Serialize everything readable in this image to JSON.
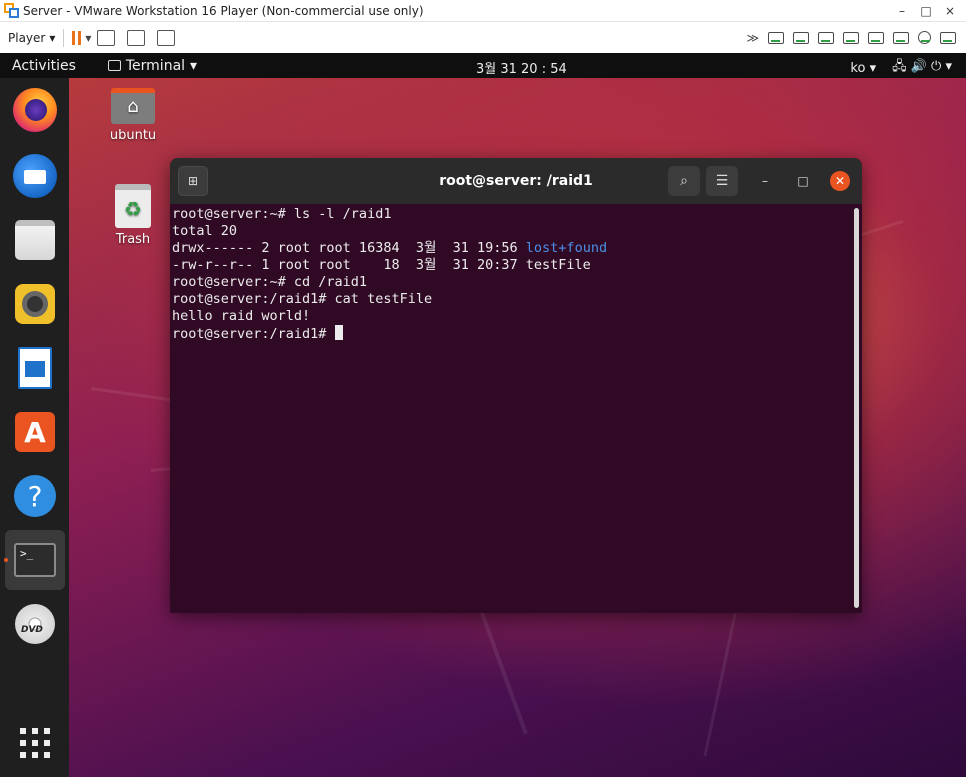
{
  "vmware": {
    "title": "Server - VMware Workstation 16 Player (Non-commercial use only)",
    "minimize": "–",
    "maximize": "□",
    "close": "×",
    "player_label": "Player",
    "player_caret": "▾",
    "more": "≫"
  },
  "topbar": {
    "activities": "Activities",
    "app_menu": "Terminal",
    "app_caret": "▾",
    "clock": "3월 31  20 : 54",
    "input_method": "ko ▾",
    "status_icons": "🖧  🔊  ⏻ ▾"
  },
  "desktop": {
    "home_label": "ubuntu",
    "trash_label": "Trash"
  },
  "dock": {
    "items": [
      "firefox",
      "thunderbird",
      "files",
      "rhythmbox",
      "libreoffice-writer",
      "software",
      "help",
      "terminal",
      "dvd"
    ]
  },
  "terminal": {
    "title": "root@server: /raid1",
    "lines": [
      {
        "text": "root@server:~# ls -l /raid1"
      },
      {
        "text": "total 20"
      },
      {
        "text": "drwx------ 2 root root 16384  3월  31 19:56 ",
        "dir": "lost+found"
      },
      {
        "text": "-rw-r--r-- 1 root root    18  3월  31 20:37 testFile"
      },
      {
        "text": "root@server:~# cd /raid1"
      },
      {
        "text": "root@server:/raid1# cat testFile"
      },
      {
        "text": "hello raid world!"
      },
      {
        "text": "root@server:/raid1# ",
        "cursor": true
      }
    ]
  },
  "colors": {
    "accent": "#e95420",
    "terminal_bg": "#300a24",
    "dir_color": "#4a8ee8"
  }
}
